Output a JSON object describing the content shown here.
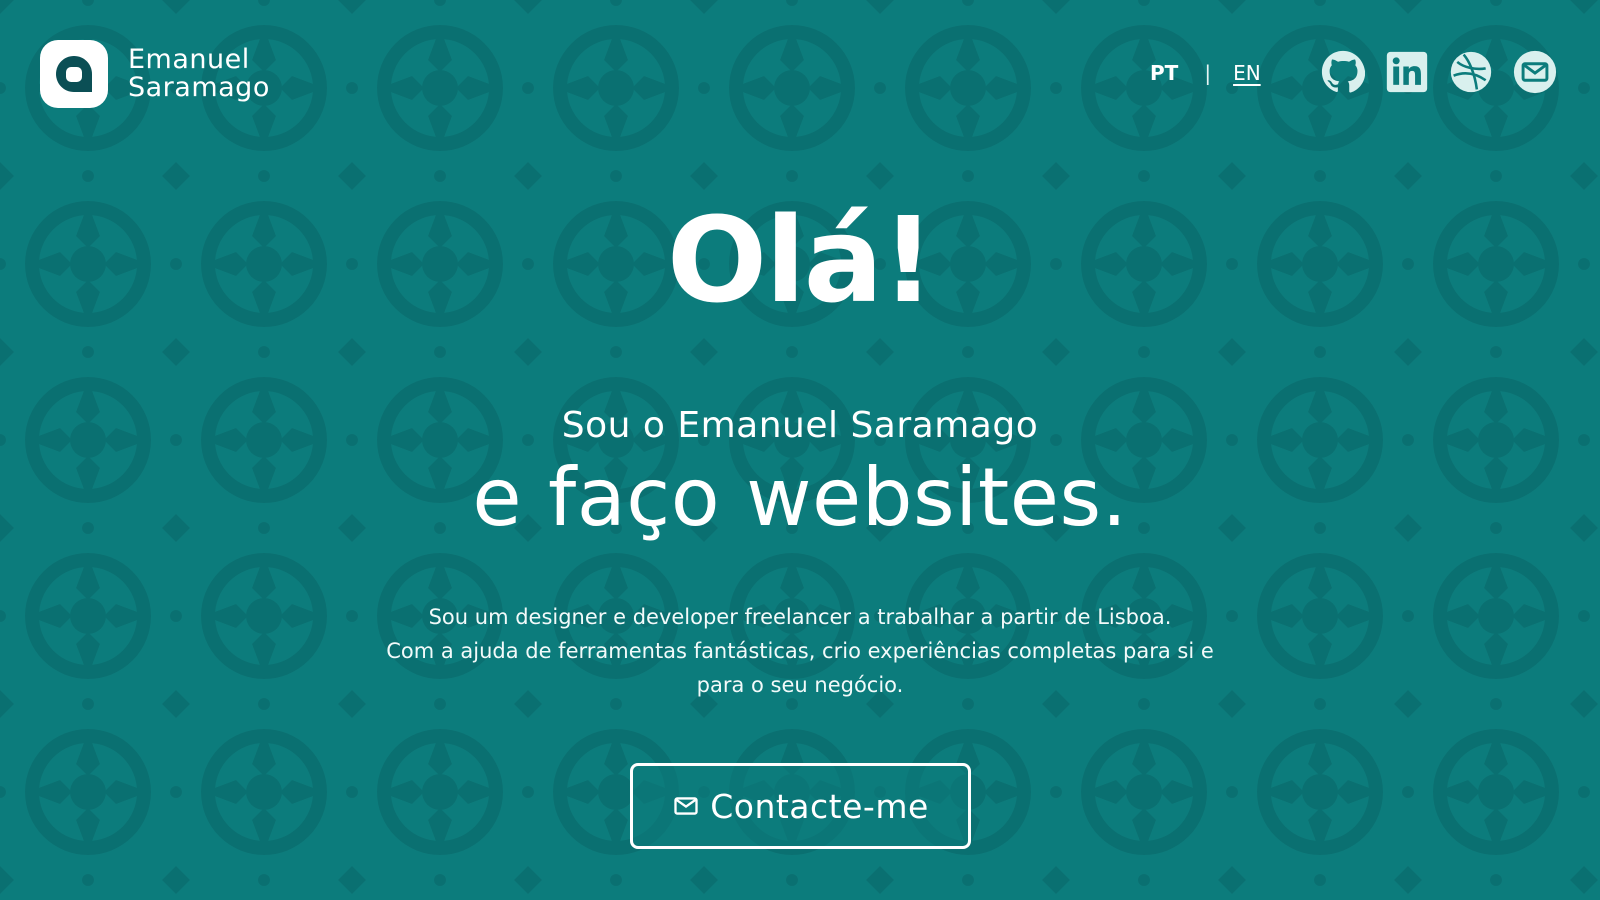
{
  "theme": {
    "background": "#0c7c7c",
    "tile_pattern": "#0a6f70",
    "text": "#ffffff",
    "logo_inner": "#0b4f55"
  },
  "header": {
    "logo": {
      "icon": "logo-a-icon",
      "name_line1": "Emanuel",
      "name_line2": "Saramago"
    },
    "language": {
      "current": "PT",
      "separator": "|",
      "alternate": "EN"
    },
    "socials": [
      {
        "icon": "github-icon",
        "label": "GitHub"
      },
      {
        "icon": "linkedin-icon",
        "label": "LinkedIn"
      },
      {
        "icon": "dribbble-icon",
        "label": "Dribbble"
      },
      {
        "icon": "email-icon",
        "label": "Email"
      }
    ]
  },
  "hero": {
    "greeting": "Olá!",
    "intro": "Sou o Emanuel Saramago",
    "tagline": "e faço websites.",
    "description_line1": "Sou um designer e developer freelancer a trabalhar a partir de Lisboa.",
    "description_line2": "Com a ajuda de ferramentas fantásticas, crio experiências completas para si e",
    "description_line3": "para o seu negócio.",
    "cta": {
      "icon": "mail-icon",
      "label": "Contacte-me"
    }
  }
}
